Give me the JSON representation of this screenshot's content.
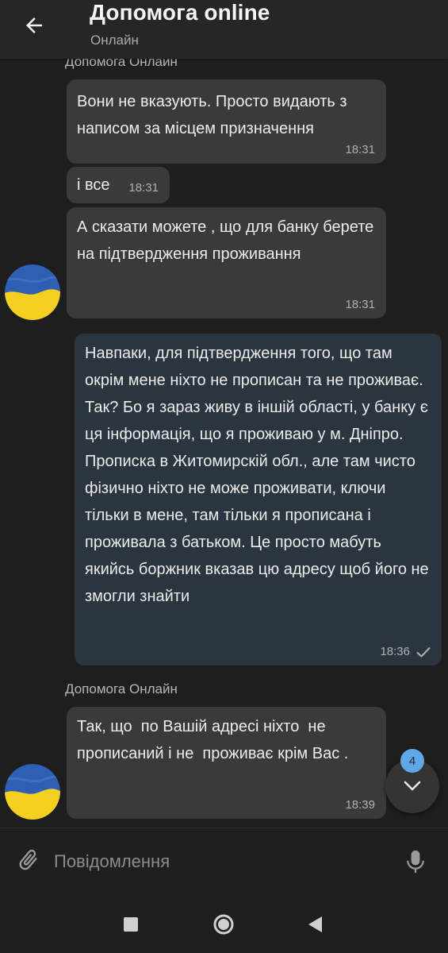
{
  "header": {
    "title": "Допомога online",
    "status": "Онлайн",
    "back_icon": "arrow-left-icon"
  },
  "messages": [
    {
      "direction": "incoming",
      "sender": "Допомога Онлайн",
      "text": "Вони не вказують. Просто видають з написом за місцем призначення",
      "time": "18:31"
    },
    {
      "direction": "incoming",
      "text": "і все",
      "time": "18:31"
    },
    {
      "direction": "incoming",
      "text": "А сказати можете , що для банку берете на підтвердження проживання",
      "time": "18:31"
    },
    {
      "direction": "outgoing",
      "text": "Навпаки, для підтвердження того, що там окрім мене ніхто не прописан та не проживає. Так? Бо я зараз живу в іншій області, у банку є ця інформація, що я проживаю у м. Дніпро. Прописка в Житомирскій обл., але там чисто фізично ніхто не може проживати, ключи тільки в мене, там тільки я прописана і проживала з батьком. Це просто мабуть якийсь боржник вказав цю адресу щоб його не змогли знайти",
      "time": "18:36",
      "status": "sent"
    },
    {
      "direction": "incoming",
      "sender": "Допомога Онлайн",
      "text": "Так, що  по Вашій адресі ніхто  не прописаний і не  проживає крім Вас .",
      "time": "18:39"
    }
  ],
  "scroll_button": {
    "unread_count": "4",
    "icon": "chevron-down-icon"
  },
  "composer": {
    "placeholder": "Повідомлення",
    "attach_icon": "paperclip-icon",
    "mic_icon": "microphone-icon"
  },
  "nav": {
    "recents_icon": "square-icon",
    "home_icon": "circle-icon",
    "back_icon": "triangle-back-icon"
  },
  "colors": {
    "background": "#1e1e1e",
    "header": "#262626",
    "incoming_bubble": "#3a3a3a",
    "outgoing_bubble": "#2b3540",
    "accent_badge": "#5fa8e6"
  }
}
